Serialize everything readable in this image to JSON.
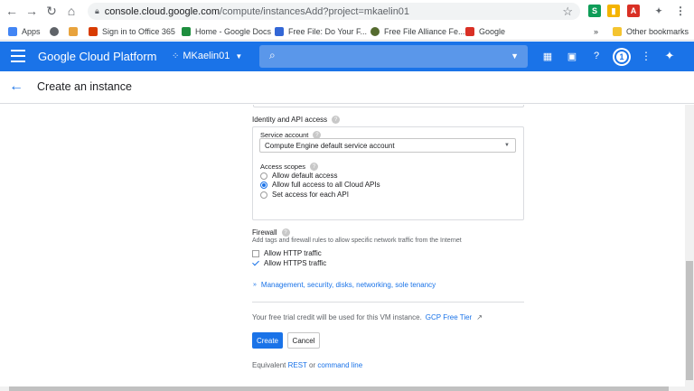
{
  "browser": {
    "url_host": "console.cloud.google.com",
    "url_rest": "/compute/instancesAdd?project=mkaelin01",
    "bookmarks": [
      {
        "label": "Apps",
        "color": "#4285f4"
      },
      {
        "label": "",
        "color": "#5f6368"
      },
      {
        "label": "",
        "color": "#e8a33d"
      },
      {
        "label": "Sign in to Office 365",
        "color": "#d83b01"
      },
      {
        "label": "Home - Google Docs",
        "color": "#1e8e3e"
      },
      {
        "label": "Free File: Do Your F...",
        "color": "#3367d6"
      },
      {
        "label": "Free File Alliance Fe...",
        "color": "#556b2f"
      },
      {
        "label": "Google",
        "color": "#d93025"
      }
    ],
    "more_bookmarks": "»",
    "other_bookmarks": "Other bookmarks"
  },
  "gcp": {
    "brand": "Google Cloud Platform",
    "project": "MKaelin01",
    "notification_count": "1"
  },
  "header": {
    "title": "Create an instance"
  },
  "form": {
    "identity_title": "Identity and API access",
    "service_account_label": "Service account",
    "service_account_value": "Compute Engine default service account",
    "access_scopes_label": "Access scopes",
    "scopes": [
      {
        "label": "Allow default access",
        "selected": false
      },
      {
        "label": "Allow full access to all Cloud APIs",
        "selected": true
      },
      {
        "label": "Set access for each API",
        "selected": false
      }
    ],
    "firewall_title": "Firewall",
    "firewall_hint": "Add tags and firewall rules to allow specific network traffic from the Internet",
    "firewall_options": [
      {
        "label": "Allow HTTP traffic",
        "checked": false
      },
      {
        "label": "Allow HTTPS traffic",
        "checked": true
      }
    ],
    "management_link": "Management, security, disks, networking, sole tenancy",
    "trial_text": "Your free trial credit will be used for this VM instance.",
    "trial_link": "GCP Free Tier",
    "create_label": "Create",
    "cancel_label": "Cancel",
    "equivalent_prefix": "Equivalent",
    "equivalent_rest": "REST",
    "equivalent_or": "or",
    "equivalent_command": "command line"
  }
}
